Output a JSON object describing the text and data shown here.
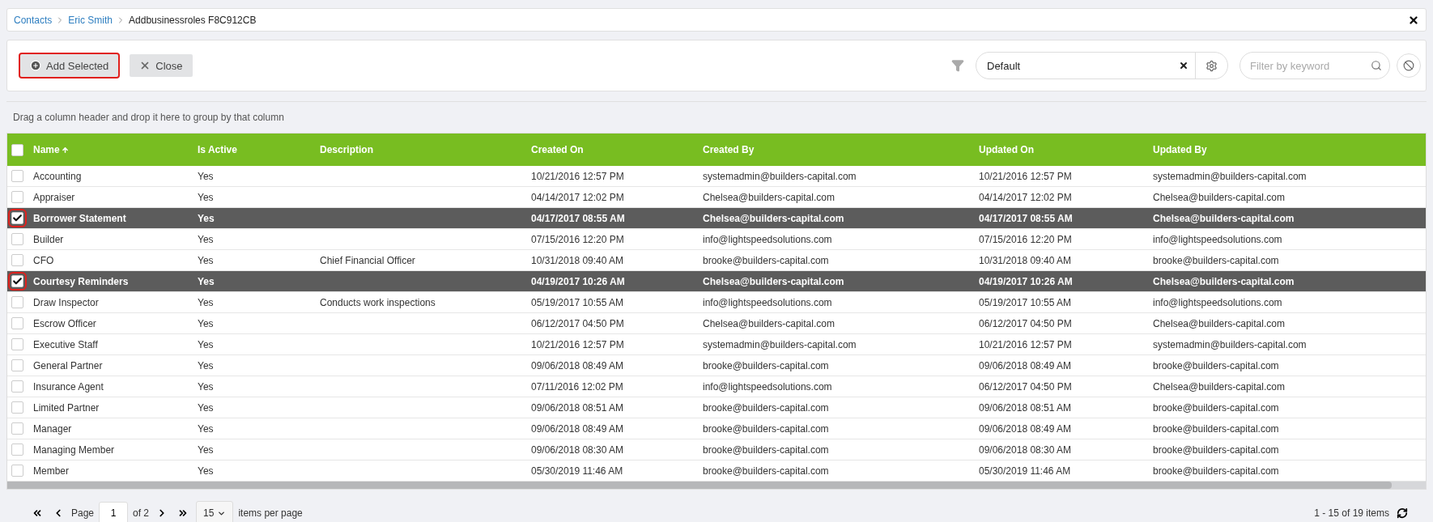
{
  "breadcrumb": [
    {
      "label": "Contacts",
      "link": true
    },
    {
      "label": "Eric Smith",
      "link": true
    },
    {
      "label": "Addbusinessroles F8C912CB",
      "link": false
    }
  ],
  "toolbar": {
    "buttons": [
      {
        "label": "Add Selected",
        "kind": "add",
        "highlighted": true
      },
      {
        "label": "Close",
        "kind": "close",
        "highlighted": false
      }
    ],
    "view": {
      "value": "Default"
    },
    "search": {
      "placeholder": "Filter by keyword"
    }
  },
  "group_hint": "Drag a column header and drop it here to group by that column",
  "table": {
    "all_checked": false,
    "columns": [
      {
        "label": "Name",
        "sorted": true
      },
      {
        "label": "Is Active",
        "sorted": false
      },
      {
        "label": "Description",
        "sorted": false
      },
      {
        "label": "Created On",
        "sorted": false
      },
      {
        "label": "Created By",
        "sorted": false
      },
      {
        "label": "Updated On",
        "sorted": false
      },
      {
        "label": "Updated By",
        "sorted": false
      }
    ],
    "rows": [
      {
        "selected": false,
        "cells": [
          "Accounting",
          "Yes",
          "",
          "10/21/2016 12:57 PM",
          "systemadmin@builders-capital.com",
          "10/21/2016 12:57 PM",
          "systemadmin@builders-capital.com"
        ]
      },
      {
        "selected": false,
        "cells": [
          "Appraiser",
          "Yes",
          "",
          "04/14/2017 12:02 PM",
          "Chelsea@builders-capital.com",
          "04/14/2017 12:02 PM",
          "Chelsea@builders-capital.com"
        ]
      },
      {
        "selected": true,
        "cells": [
          "Borrower Statement",
          "Yes",
          "",
          "04/17/2017 08:55 AM",
          "Chelsea@builders-capital.com",
          "04/17/2017 08:55 AM",
          "Chelsea@builders-capital.com"
        ]
      },
      {
        "selected": false,
        "cells": [
          "Builder",
          "Yes",
          "",
          "07/15/2016 12:20 PM",
          "info@lightspeedsolutions.com",
          "07/15/2016 12:20 PM",
          "info@lightspeedsolutions.com"
        ]
      },
      {
        "selected": false,
        "cells": [
          "CFO",
          "Yes",
          "Chief Financial Officer",
          "10/31/2018 09:40 AM",
          "brooke@builders-capital.com",
          "10/31/2018 09:40 AM",
          "brooke@builders-capital.com"
        ]
      },
      {
        "selected": true,
        "cells": [
          "Courtesy Reminders",
          "Yes",
          "",
          "04/19/2017 10:26 AM",
          "Chelsea@builders-capital.com",
          "04/19/2017 10:26 AM",
          "Chelsea@builders-capital.com"
        ]
      },
      {
        "selected": false,
        "cells": [
          "Draw Inspector",
          "Yes",
          "Conducts work inspections",
          "05/19/2017 10:55 AM",
          "info@lightspeedsolutions.com",
          "05/19/2017 10:55 AM",
          "info@lightspeedsolutions.com"
        ]
      },
      {
        "selected": false,
        "cells": [
          "Escrow Officer",
          "Yes",
          "",
          "06/12/2017 04:50 PM",
          "Chelsea@builders-capital.com",
          "06/12/2017 04:50 PM",
          "Chelsea@builders-capital.com"
        ]
      },
      {
        "selected": false,
        "cells": [
          "Executive Staff",
          "Yes",
          "",
          "10/21/2016 12:57 PM",
          "systemadmin@builders-capital.com",
          "10/21/2016 12:57 PM",
          "systemadmin@builders-capital.com"
        ]
      },
      {
        "selected": false,
        "cells": [
          "General Partner",
          "Yes",
          "",
          "09/06/2018 08:49 AM",
          "brooke@builders-capital.com",
          "09/06/2018 08:49 AM",
          "brooke@builders-capital.com"
        ]
      },
      {
        "selected": false,
        "cells": [
          "Insurance Agent",
          "Yes",
          "",
          "07/11/2016 12:02 PM",
          "info@lightspeedsolutions.com",
          "06/12/2017 04:50 PM",
          "Chelsea@builders-capital.com"
        ]
      },
      {
        "selected": false,
        "cells": [
          "Limited Partner",
          "Yes",
          "",
          "09/06/2018 08:51 AM",
          "brooke@builders-capital.com",
          "09/06/2018 08:51 AM",
          "brooke@builders-capital.com"
        ]
      },
      {
        "selected": false,
        "cells": [
          "Manager",
          "Yes",
          "",
          "09/06/2018 08:49 AM",
          "brooke@builders-capital.com",
          "09/06/2018 08:49 AM",
          "brooke@builders-capital.com"
        ]
      },
      {
        "selected": false,
        "cells": [
          "Managing Member",
          "Yes",
          "",
          "09/06/2018 08:30 AM",
          "brooke@builders-capital.com",
          "09/06/2018 08:30 AM",
          "brooke@builders-capital.com"
        ]
      },
      {
        "selected": false,
        "cells": [
          "Member",
          "Yes",
          "",
          "05/30/2019 11:46 AM",
          "brooke@builders-capital.com",
          "05/30/2019 11:46 AM",
          "brooke@builders-capital.com"
        ]
      }
    ]
  },
  "pager": {
    "page_label": "Page",
    "page": "1",
    "of": "of 2",
    "page_size": "15",
    "page_size_label": "items per page",
    "summary": "1 - 15 of 19 items"
  }
}
